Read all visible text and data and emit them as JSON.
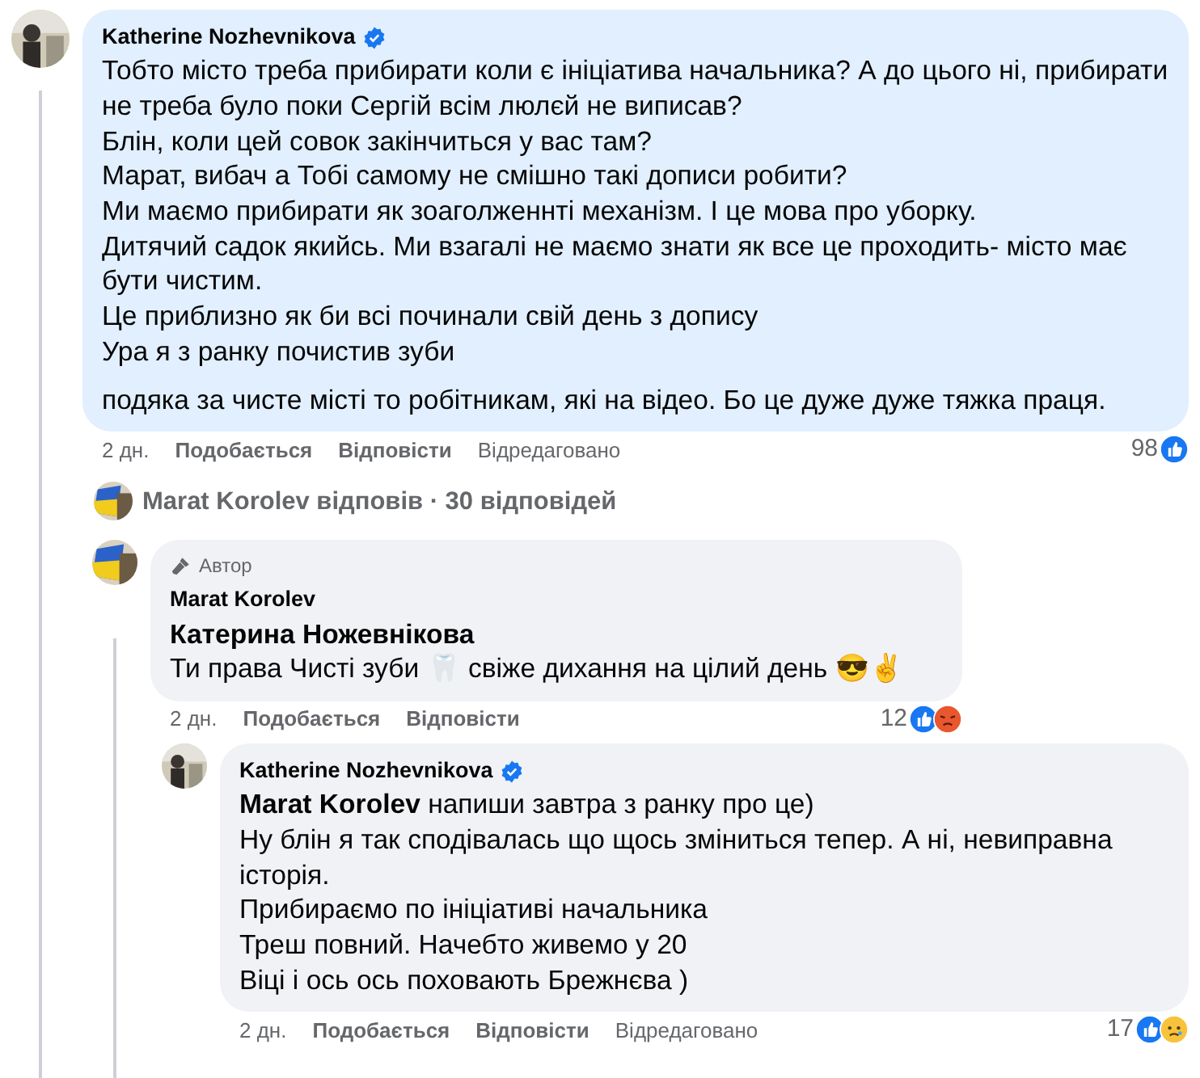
{
  "comments": [
    {
      "author": "Katherine Nozhevnikova",
      "verified": true,
      "highlighted": true,
      "paragraphs": [
        [
          "Тобто місто треба прибирати коли є ініціатива начальника? А до цього ні, прибирати не треба було поки Сергій всім люлєй не виписав?",
          "Блін, коли цей совок закінчиться у вас там?",
          "Марат, вибач а Тобі самому не смішно такі дописи робити?",
          "Ми маємо прибирати як зоаголженнті механізм. І це мова про уборку.",
          "Дитячий садок якийсь. Ми взагалі не маємо знати як все це проходить- місто має бути чистим.",
          "Це приблизно як би всі починали свій день з допису",
          "Ура я з ранку почистив зуби"
        ],
        [
          "подяка за чисте місті то робітникам, які на відео. Бо це дуже дуже тяжка праця."
        ]
      ],
      "time": "2 дн.",
      "actions": [
        "Подобається",
        "Відповісти",
        "Відредаговано"
      ],
      "reaction_count": "98",
      "reactions": [
        {
          "kind": "like"
        }
      ],
      "reply_summary": "Marat Korolev відповів · 30 відповідей",
      "children": [
        {
          "author": "Marat Korolev",
          "verified": false,
          "highlighted": false,
          "badge": "Автор",
          "paragraphs": [
            [
              "**Катерина Ножевнікова**",
              "Ти права Чисті зуби 🦷 свіже дихання на цілий день 😎✌️"
            ]
          ],
          "time": "2 дн.",
          "actions": [
            "Подобається",
            "Відповісти"
          ],
          "reaction_count": "12",
          "reactions": [
            {
              "kind": "like"
            },
            {
              "kind": "angry"
            }
          ],
          "children": [
            {
              "author": "Katherine Nozhevnikova",
              "verified": true,
              "highlighted": false,
              "paragraphs": [
                [
                  "**Marat Korolev** напиши завтра з ранку про це)",
                  "Ну блін я так сподівалась що щось зміниться тепер. А ні, невиправна історія.",
                  "Прибираємо по ініціативі начальника",
                  "Треш повний. Начебто живемо у 20",
                  "Віці і ось ось поховають Брежнєва )"
                ]
              ],
              "time": "2 дн.",
              "actions": [
                "Подобається",
                "Відповісти",
                "Відредаговано"
              ],
              "reaction_count": "17",
              "reactions": [
                {
                  "kind": "like"
                },
                {
                  "kind": "sad"
                }
              ]
            }
          ]
        }
      ]
    }
  ]
}
